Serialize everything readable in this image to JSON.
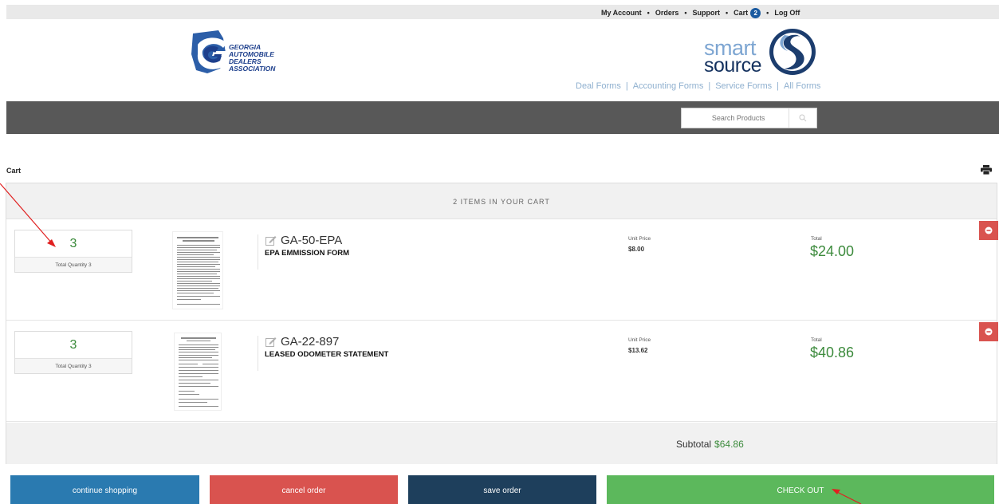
{
  "top_nav": {
    "my_account": "My Account",
    "orders": "Orders",
    "support": "Support",
    "cart": "Cart",
    "cart_count": "2",
    "log_off": "Log Off",
    "separator": "•"
  },
  "header": {
    "gada_logo_lines": [
      "GEORGIA",
      "AUTOMOBILE",
      "DEALERS",
      "ASSOCIATION"
    ],
    "smart_logo_top": "smart",
    "smart_logo_bottom": "source",
    "form_links": [
      "Deal Forms",
      "Accounting Forms",
      "Service Forms",
      "All Forms"
    ]
  },
  "search": {
    "placeholder": "Search Products"
  },
  "page": {
    "cart_label": "Cart",
    "cart_header": "2 ITEMS IN YOUR CART"
  },
  "items": [
    {
      "quantity": "3",
      "quantity_label": "Total Quantity 3",
      "sku": "GA-50-EPA",
      "name": "EPA EMMISSION FORM",
      "unit_price_label": "Unit Price",
      "unit_price": "$8.00",
      "total_label": "Total",
      "total": "$24.00"
    },
    {
      "quantity": "3",
      "quantity_label": "Total Quantity 3",
      "sku": "GA-22-897",
      "name": "LEASED ODOMETER STATEMENT",
      "unit_price_label": "Unit Price",
      "unit_price": "$13.62",
      "total_label": "Total",
      "total": "$40.86"
    }
  ],
  "summary": {
    "subtotal_label": "Subtotal",
    "subtotal": "$64.86"
  },
  "buttons": {
    "continue": "continue shopping",
    "cancel": "cancel order",
    "save": "save order",
    "checkout": "CHECK OUT"
  },
  "colors": {
    "accent_green": "#3d8b3d",
    "danger": "#d9534f",
    "continue_blue": "#2a7ab0",
    "save_navy": "#1e3f5c",
    "checkout_green": "#5cb85c",
    "header_band": "#585858"
  },
  "icons": {
    "search": "search-icon",
    "print": "print-icon",
    "edit": "edit-icon",
    "remove": "remove-icon"
  }
}
